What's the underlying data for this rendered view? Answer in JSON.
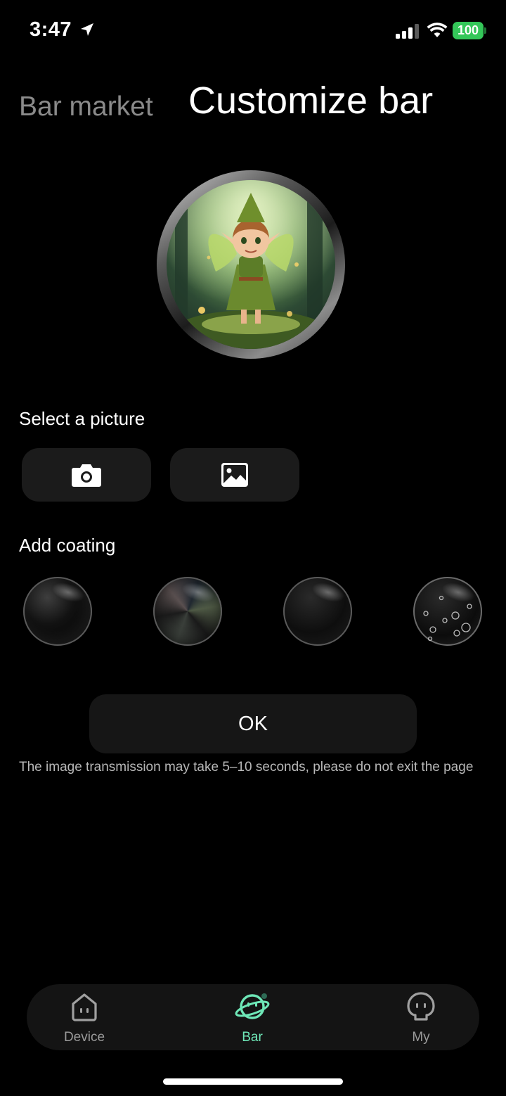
{
  "status_bar": {
    "time": "3:47",
    "battery": "100"
  },
  "header": {
    "tab_inactive": "Bar market",
    "tab_active": "Customize bar"
  },
  "select_picture": {
    "label": "Select a picture",
    "buttons": [
      "camera-icon",
      "gallery-icon"
    ]
  },
  "coating": {
    "label": "Add coating",
    "options": [
      "glossy-black",
      "iridescent",
      "matte-black",
      "bubble"
    ]
  },
  "ok_label": "OK",
  "note": "The image transmission may take 5–10 seconds, please do not exit the page",
  "nav": {
    "items": [
      {
        "label": "Device",
        "icon": "device-home-icon"
      },
      {
        "label": "Bar",
        "icon": "planet-face-icon",
        "active": true
      },
      {
        "label": "My",
        "icon": "profile-face-icon"
      }
    ]
  },
  "colors": {
    "accent": "#6ee7b7",
    "battery": "#34c759",
    "background": "#000000"
  }
}
